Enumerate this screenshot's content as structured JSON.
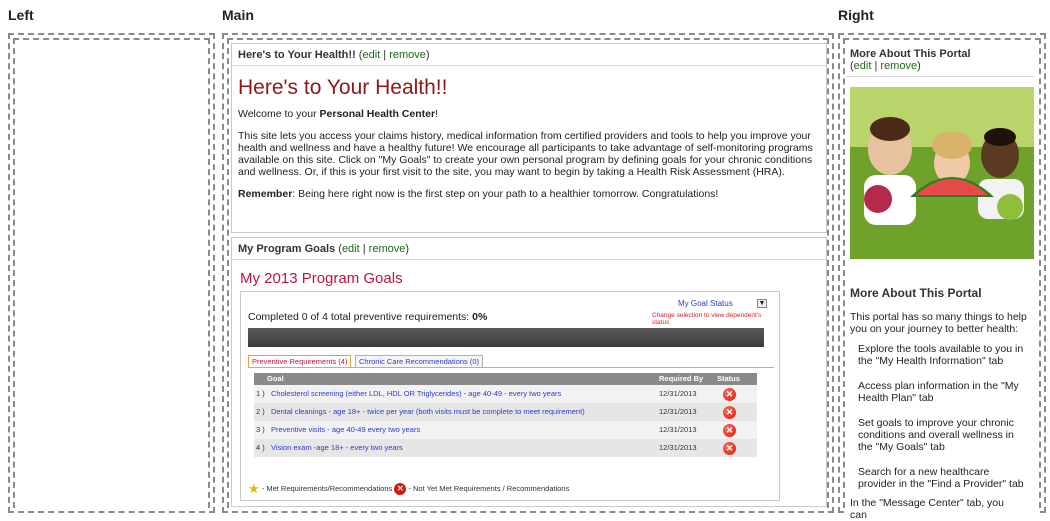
{
  "columns": {
    "left": "Left",
    "main": "Main",
    "right": "Right"
  },
  "health": {
    "header_title": "Here's to Your Health!!",
    "edit": "edit",
    "remove": "remove",
    "big_title": "Here's to Your Health!!",
    "welcome_prefix": "Welcome to your ",
    "welcome_bold": "Personal Health Center",
    "welcome_suffix": "!",
    "para": "This site lets you access your claims history, medical information from certified providers and tools to help you improve your health and wellness and have a healthy future!  We encourage all participants to take advantage of self-monitoring programs available on this site. Click on \"My Goals\" to create your own personal program by defining goals for your chronic conditions and wellness. Or, if this is your first visit to the site, you may want to begin by taking a Health Risk Assessment (HRA).",
    "remember_label": "Remember",
    "remember_text": ": Being here right now is the first step on your path to a healthier tomorrow. Congratulations!"
  },
  "goals": {
    "header_title": "My Program Goals",
    "edit": "edit",
    "remove": "remove",
    "title": "My 2013 Program Goals",
    "completed_text": "Completed 0 of 4 total preventive requirements: ",
    "completed_pct": "0%",
    "status_link": "My Goal Status",
    "change_note": "Change selection to view dependent's status",
    "tabs": [
      "Preventive Requirements (4)",
      "Chronic Care Recommendations (0)"
    ],
    "columns": [
      "Goal",
      "Required By",
      "Status"
    ],
    "rows": [
      {
        "num": "1 )",
        "goal": "Cholesterol screening (either LDL, HDL OR Triglycerides) - age 40-49 - every two years",
        "date": "12/31/2013"
      },
      {
        "num": "2 )",
        "goal": "Dental cleanings - age 18+ - twice per year (both visits must be complete to meet requirement)",
        "date": "12/31/2013"
      },
      {
        "num": "3 )",
        "goal": "Preventive visits - age 40-49 every two years",
        "date": "12/31/2013"
      },
      {
        "num": "4 )",
        "goal": "Vision exam -age 18+ - every two years",
        "date": "12/31/2013"
      }
    ],
    "legend_met": "- Met Requirements/Recommendations",
    "legend_not": "- Not Yet Met Requirements / Recommendations"
  },
  "portal": {
    "header_title": "More About This Portal",
    "edit": "edit",
    "remove": "remove",
    "title": "More About This Portal",
    "intro": "This portal has so many things to help you on your journey to better health:",
    "items": [
      "Explore the tools available to you in the \"My Health Information\" tab",
      "Access plan information in the \"My Health Plan\" tab",
      "Set goals to improve your chronic conditions and overall wellness in the \"My Goals\" tab",
      "Search for a new healthcare provider in the \"Find a Provider\" tab",
      "In the \"Message Center\" tab, you can"
    ]
  },
  "colors": {
    "title_red": "#8b1a1a",
    "goals_red": "#c0143c",
    "link_green": "#1a6a1a",
    "link_blue": "#2d3bd0"
  }
}
